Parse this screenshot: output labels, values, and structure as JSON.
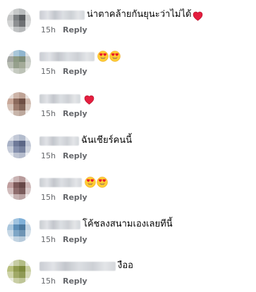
{
  "comments": [
    {
      "text": "น่าตาคล้ายกันยุนะว่าไม่ได้",
      "reactions": [
        "heart-icon"
      ],
      "time": "15h",
      "reply_label": "Reply",
      "avatar_colors": [
        "#dfe0e0",
        "#c7c9c9",
        "#b9bcbd",
        "#e4e5e5",
        "#c4c5c5",
        "#7d8082",
        "#5b5e61",
        "#cfd0d0",
        "#d2d3d3",
        "#8e9092",
        "#6f7174",
        "#d8d9d9",
        "#e9eaea",
        "#c0c2c3",
        "#b6b8b9",
        "#eeeeee"
      ]
    },
    {
      "text": "",
      "reactions": [
        "heart-eyes-icon",
        "heart-eyes-icon"
      ],
      "time": "15h",
      "reply_label": "Reply",
      "avatar_colors": [
        "#d7dce0",
        "#a9c7d9",
        "#90b6cf",
        "#dde1e4",
        "#a3a6a1",
        "#8d9a83",
        "#7f8d78",
        "#c7cbc6",
        "#b8bdb3",
        "#96a08d",
        "#a4ab99",
        "#d0d3cd",
        "#e2e4e1",
        "#c6cbc1",
        "#bcc2b6",
        "#eceeea"
      ]
    },
    {
      "text": "",
      "reactions": [
        "heart-icon"
      ],
      "time": "15h",
      "reply_label": "Reply",
      "avatar_colors": [
        "#e6dcd7",
        "#cdb4a8",
        "#bfa396",
        "#e8e1dd",
        "#c9a899",
        "#8c6a5c",
        "#6e4f44",
        "#cfb9ad",
        "#d6c3b8",
        "#9d7c6e",
        "#836659",
        "#dacbc2",
        "#eae4e0",
        "#c8b5aa",
        "#bda89d",
        "#efebe8"
      ]
    },
    {
      "text": "ฉันเชียร์คนนี้",
      "reactions": [],
      "time": "15h",
      "reply_label": "Reply",
      "avatar_colors": [
        "#e0e3ea",
        "#c3c9d7",
        "#b3bccd",
        "#e3e6ec",
        "#a8b1c6",
        "#6f7a99",
        "#5c6786",
        "#bfc6d5",
        "#c6ccd9",
        "#8590ad",
        "#77829f",
        "#cfd4de",
        "#e5e8ee",
        "#bfc5d3",
        "#b5bccd",
        "#eceef3"
      ]
    },
    {
      "text": "",
      "reactions": [
        "heart-eyes-icon",
        "heart-eyes-icon"
      ],
      "time": "15h",
      "reply_label": "Reply",
      "avatar_colors": [
        "#e5dcdc",
        "#c9b3b3",
        "#b89b9b",
        "#e7dfdf",
        "#bf9d9d",
        "#7d5a5a",
        "#674848",
        "#ccb5b5",
        "#d1bcbc",
        "#8e6c6c",
        "#7a5b5b",
        "#d8c8c8",
        "#eae3e3",
        "#c6b2b2",
        "#baa3a3",
        "#efeaea"
      ]
    },
    {
      "text": "โค้ชลงสนามเองเลยทีนี้",
      "reactions": [],
      "time": "15h",
      "reply_label": "Reply",
      "avatar_colors": [
        "#dfe7ee",
        "#9fc3e0",
        "#7fb0d8",
        "#e1e8ee",
        "#a9c6dd",
        "#5d8fb8",
        "#4c7aa0",
        "#c3d5e4",
        "#c7d8e6",
        "#7fa6c6",
        "#6e94b4",
        "#d3e0ea",
        "#e6edf3",
        "#c1d3e2",
        "#b6cadb",
        "#edf2f6"
      ]
    },
    {
      "text": "งืออ",
      "reactions": [],
      "time": "15h",
      "reply_label": "Reply",
      "avatar_colors": [
        "#e5e7d9",
        "#c6cca3",
        "#b3bd86",
        "#e7e9dd",
        "#b8c07e",
        "#8f9a4f",
        "#7d8a3d",
        "#c8ce9f",
        "#ced3a8",
        "#a0a967",
        "#8f9a56",
        "#d6dab9",
        "#eaecde",
        "#c9cea4",
        "#bec597",
        "#eff0e6"
      ]
    }
  ]
}
